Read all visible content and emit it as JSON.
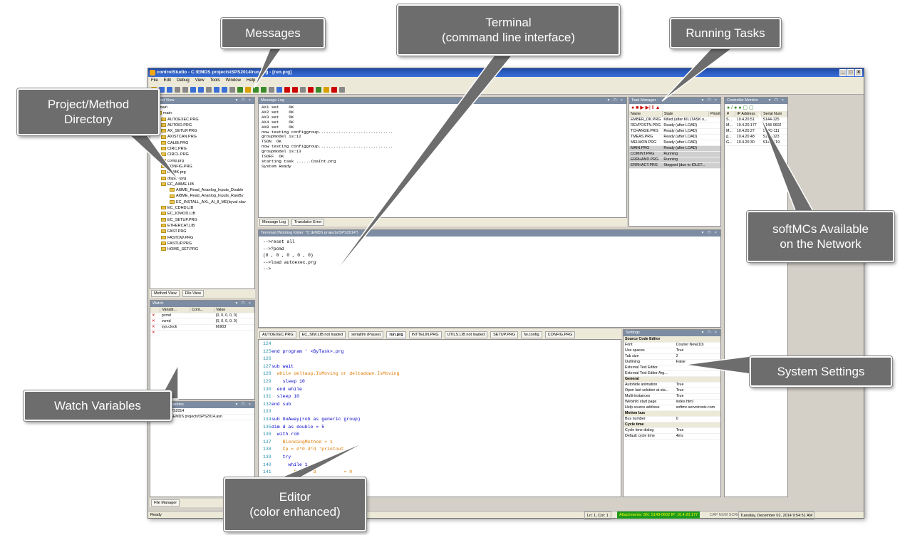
{
  "app": {
    "title": "controlStudio - C:\\EMDS projects\\SPS2014\\run.prg - [run.prg]",
    "menu": [
      "File",
      "Edit",
      "Debug",
      "View",
      "Tools",
      "Window",
      "Help"
    ]
  },
  "panels": {
    "project": {
      "title": "Project View",
      "tabs": [
        "Method View",
        "File View"
      ]
    },
    "messages": {
      "title": "Message Log",
      "tabs": [
        "Message Log",
        "Translator Error"
      ]
    },
    "tasks": {
      "title": "Task Manager"
    },
    "controllers": {
      "title": "Controller Monitor"
    },
    "terminal": {
      "title": "Terminal (Working folder: \"C:\\EMDS projects\\SPS2014\")"
    },
    "watch": {
      "title": "Watch"
    },
    "properties": {
      "title": "Project Properties"
    },
    "settings": {
      "title": "Settings"
    }
  },
  "tree": [
    "main",
    "main",
    "AUTOEXEC.PRG",
    "AUTOID.PRG",
    "AX_SETUP.PRG",
    "AXISTCAN.PRG",
    "CALIB.PRG",
    "CIRC.PRG",
    "CIRCL.PRG",
    "comp.prg",
    "CONFIG.PRG",
    "DCMK.prg",
    "display.prg",
    "EC_AI8ME.LIB",
    "AI8ME_Read_Ananlog_Inputs_Double",
    "AI8ME_Read_Ananlog_Inputs_RawBy",
    "EC_INSTALL_AXL_AI_8_ME(byval slav",
    "EC_CDHD.LIB",
    "EC_IOMOD.LIB",
    "EC_SETUP.PRG",
    "ETHERCAT.LIB",
    "FAST.PRG",
    "FASTOW.PRG",
    "FASTUP.PRG",
    "HOME_SET.PRG"
  ],
  "message_log": [
    "AX1 set    OK",
    "AX2 set    OK",
    "AX3 set    OK",
    "AX4 set    OK",
    "AX8 set    OK",
    "now testing configgroup..............................",
    "groupmodel is:12",
    "TSON  OK",
    "now testing configgroup..............................",
    "groupmodel is:13",
    "TSOFF  OK",
    "starting task ......CoaInt.prg",
    "System Ready"
  ],
  "tasks": {
    "headers": [
      "Name",
      "State",
      "Priority"
    ],
    "rows": [
      [
        "EMBER_OK.PRG",
        "Killed (after KILLTASK o..."
      ],
      [
        "REVPOSTN.PRG",
        "Ready (after LOAD)"
      ],
      [
        "TCHANGE.PRG",
        "Ready (after LOAD)"
      ],
      [
        "TMEAS.PRG",
        "Ready (after LOAD)"
      ],
      [
        "MELMON.PRG",
        "Ready (after LOAD)"
      ],
      [
        "MAIN.PRG",
        "Ready (after LOAD)"
      ],
      [
        "COMINT.PRG",
        "Running"
      ],
      [
        "ERRHAND.PRG",
        "Running"
      ],
      [
        "ERRHACT.PRG",
        "Stopped (due to IDLET..."
      ]
    ]
  },
  "controllers": {
    "headers": [
      "IP Address",
      "Serial Num"
    ],
    "rows": [
      [
        "S...",
        "10.4.20.51",
        "S144-125"
      ],
      [
        "M...",
        "10.4.20.177",
        "S148-0602"
      ],
      [
        "M...",
        "10.4.20.27",
        "S14C-111"
      ],
      [
        "g...",
        "10.4.20.48",
        "S14L-123"
      ],
      [
        "G...",
        "10.4.20.30",
        "S14D-119"
      ]
    ]
  },
  "terminal": [
    "-->reset all",
    "-->?pcmd",
    "(0 , 0 , 0 , 0 , 0)",
    "-->load autoexec.prg",
    "-->"
  ],
  "watch": {
    "headers": [
      "Variabl...",
      "Cont...",
      "Value"
    ],
    "rows": [
      [
        "pcmd",
        "",
        "(0, 0, 0, 0, 0)"
      ],
      [
        "vcmd",
        "",
        "(0, 0, 0, 0, 0)"
      ],
      [
        "sys.clock",
        "",
        "66903"
      ]
    ]
  },
  "properties": [
    [
      "",
      "SPS2014"
    ],
    [
      "Path",
      "C:\\EMDS projects\\SPS2014.asn"
    ]
  ],
  "editor_tabs": [
    "AUTOEXEC.PRG",
    "EC_SIM.LIB not loaded",
    "serialitm (Pause)",
    "run.prg",
    "INTTELIN.PRG",
    "UTILS.LIB not loaded",
    "SETUP.PRG",
    "fw.config",
    "CONFIG.PRG"
  ],
  "editor": [
    {
      "n": "124",
      "t": ""
    },
    {
      "n": "125",
      "t": "end program ' <ByTask>.prg"
    },
    {
      "n": "126",
      "t": ""
    },
    {
      "n": "127",
      "t": "sub wait"
    },
    {
      "n": "128",
      "t": "  while deltaup.IsMoving or deltadown.IsMoving"
    },
    {
      "n": "129",
      "t": "    sleep 10"
    },
    {
      "n": "130",
      "t": "  end while"
    },
    {
      "n": "131",
      "t": "  sleep 10"
    },
    {
      "n": "132",
      "t": "end sub"
    },
    {
      "n": "133",
      "t": ""
    },
    {
      "n": "134",
      "t": "sub GoAway(rob as generic group)"
    },
    {
      "n": "135",
      "t": "dim d as double = 5"
    },
    {
      "n": "136",
      "t": "  with rob"
    },
    {
      "n": "137",
      "t": "    BlendingMethod = 1"
    },
    {
      "n": "138",
      "t": "    Cp = d*0.4*d 'printout..."
    },
    {
      "n": "139",
      "t": "    try"
    },
    {
      "n": "140",
      "t": "      while 1"
    },
    {
      "n": "141",
      "t": "        Moves  d          = 0"
    }
  ],
  "settings": [
    {
      "group": "Source Code Editor"
    },
    [
      "Font",
      "Courier New(10)"
    ],
    [
      "Use spaces",
      "True"
    ],
    [
      "Tab size",
      "2"
    ],
    [
      "Outlining",
      "False"
    ],
    [
      "External Text Editor",
      ""
    ],
    [
      "External Text Editor Arg...",
      ""
    ],
    {
      "group": "General"
    },
    [
      "Autohide animation",
      "True"
    ],
    [
      "Open last solution at sta...",
      "True"
    ],
    [
      "Multi-instances",
      "True"
    ],
    [
      "Webinfo start page",
      "index.html"
    ],
    [
      "Help source address",
      "softmc.servotronix.com"
    ],
    {
      "group": "Motion bus"
    },
    [
      "Bus number",
      "0"
    ],
    {
      "group": "Cycle time"
    },
    [
      "Cycle time dialog",
      "True"
    ],
    [
      "Default cycle time",
      "4ms"
    ]
  ],
  "statusbar": {
    "left": "Ready",
    "pos": "Ln: 1, Col: 1",
    "conn": "Attachments: SN: S148-0602 IP: 10.4.20.177",
    "flags": "CAP NUM SCRL",
    "date": "Tuesday, December 02, 2014 9:54:51 AM",
    "file_manager": "File Manager"
  },
  "callouts": {
    "messages": "Messages",
    "terminal": "Terminal\n(command line interface)",
    "tasks": "Running Tasks",
    "project": "Project/Method\nDirectory",
    "softmc": "softMCs Available\non the Network",
    "settings": "System Settings",
    "watch": "Watch Variables",
    "editor": "Editor\n(color enhanced)"
  }
}
